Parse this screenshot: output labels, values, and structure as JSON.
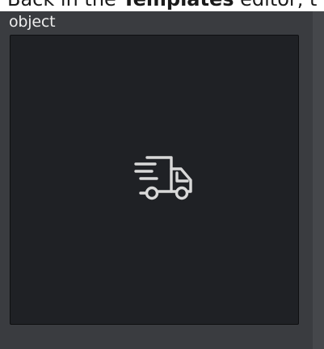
{
  "doc": {
    "text_before": "Back in the ",
    "text_bold": "Templates",
    "text_after": " editor, t"
  },
  "field": {
    "label": "object"
  },
  "preview": {
    "icon": "delivery-truck-icon",
    "background": "#1f2125",
    "icon_color": "#d9d9d9"
  }
}
